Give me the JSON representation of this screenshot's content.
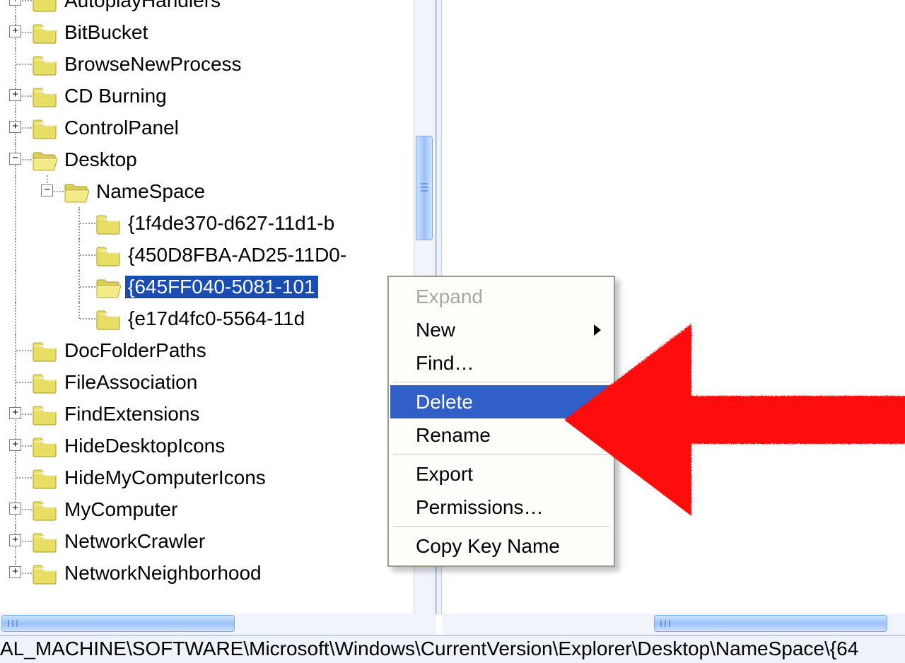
{
  "tree": {
    "items": [
      {
        "label": "AutoplayHandlers",
        "depth": 1,
        "expander": "+",
        "open": false,
        "selected": false
      },
      {
        "label": "BitBucket",
        "depth": 1,
        "expander": "+",
        "open": false,
        "selected": false
      },
      {
        "label": "BrowseNewProcess",
        "depth": 1,
        "expander": null,
        "open": false,
        "selected": false
      },
      {
        "label": "CD Burning",
        "depth": 1,
        "expander": "+",
        "open": false,
        "selected": false
      },
      {
        "label": "ControlPanel",
        "depth": 1,
        "expander": "+",
        "open": false,
        "selected": false
      },
      {
        "label": "Desktop",
        "depth": 1,
        "expander": "-",
        "open": true,
        "selected": false
      },
      {
        "label": "NameSpace",
        "depth": 2,
        "expander": "-",
        "open": true,
        "selected": false
      },
      {
        "label": "{1f4de370-d627-11d1-b",
        "depth": 3,
        "expander": null,
        "open": false,
        "selected": false
      },
      {
        "label": "{450D8FBA-AD25-11D0-",
        "depth": 3,
        "expander": null,
        "open": false,
        "selected": false
      },
      {
        "label": "{645FF040-5081-101",
        "depth": 3,
        "expander": null,
        "open": true,
        "selected": true
      },
      {
        "label": "{e17d4fc0-5564-11d",
        "depth": 3,
        "expander": null,
        "open": false,
        "selected": false
      },
      {
        "label": "DocFolderPaths",
        "depth": 1,
        "expander": null,
        "open": false,
        "selected": false
      },
      {
        "label": "FileAssociation",
        "depth": 1,
        "expander": null,
        "open": false,
        "selected": false
      },
      {
        "label": "FindExtensions",
        "depth": 1,
        "expander": "+",
        "open": false,
        "selected": false
      },
      {
        "label": "HideDesktopIcons",
        "depth": 1,
        "expander": "+",
        "open": false,
        "selected": false
      },
      {
        "label": "HideMyComputerIcons",
        "depth": 1,
        "expander": null,
        "open": false,
        "selected": false
      },
      {
        "label": "MyComputer",
        "depth": 1,
        "expander": "+",
        "open": false,
        "selected": false
      },
      {
        "label": "NetworkCrawler",
        "depth": 1,
        "expander": "+",
        "open": false,
        "selected": false
      },
      {
        "label": "NetworkNeighborhood",
        "depth": 1,
        "expander": "+",
        "open": false,
        "selected": false
      }
    ]
  },
  "context_menu": {
    "items": [
      {
        "label": "Expand",
        "disabled": true,
        "submenu": false,
        "highlighted": false
      },
      {
        "label": "New",
        "disabled": false,
        "submenu": true,
        "highlighted": false
      },
      {
        "label": "Find…",
        "disabled": false,
        "submenu": false,
        "highlighted": false
      },
      {
        "sep": true
      },
      {
        "label": "Delete",
        "disabled": false,
        "submenu": false,
        "highlighted": true
      },
      {
        "label": "Rename",
        "disabled": false,
        "submenu": false,
        "highlighted": false
      },
      {
        "sep": true
      },
      {
        "label": "Export",
        "disabled": false,
        "submenu": false,
        "highlighted": false
      },
      {
        "label": "Permissions…",
        "disabled": false,
        "submenu": false,
        "highlighted": false
      },
      {
        "sep": true
      },
      {
        "label": "Copy Key Name",
        "disabled": false,
        "submenu": false,
        "highlighted": false
      }
    ]
  },
  "statusbar": {
    "path": "AL_MACHINE\\SOFTWARE\\Microsoft\\Windows\\CurrentVersion\\Explorer\\Desktop\\NameSpace\\{64"
  },
  "annotation": {
    "color": "#ff0a0a"
  }
}
